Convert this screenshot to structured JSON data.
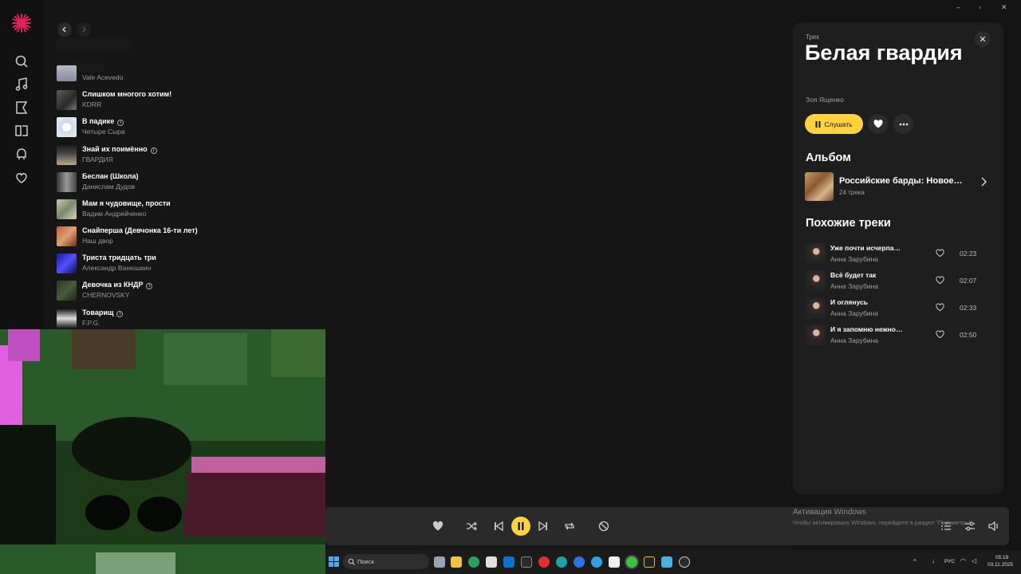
{
  "tracks": [
    {
      "title": "",
      "artist": "Vale Acevedo",
      "info": false
    },
    {
      "title": "Слишком многого хотим!",
      "artist": "KDRR",
      "info": false
    },
    {
      "title": "В падике",
      "artist": "Четыре Сыра",
      "info": true
    },
    {
      "title": "Знай их поимённо",
      "artist": "ГВАРДИЯ",
      "info": true
    },
    {
      "title": "Беслан (Школа)",
      "artist": "Данислам Дудов",
      "info": false
    },
    {
      "title": "Мам я чудовище, прости",
      "artist": "Вадим Андрейченко",
      "info": false
    },
    {
      "title": "Снайперша (Девчонка 16-ти лет)",
      "artist": "Наш двор",
      "info": false
    },
    {
      "title": "Триста тридцать три",
      "artist": "Александр Ванюшкин",
      "info": false
    },
    {
      "title": "Девочка из КНДР",
      "artist": "CHERNOVSKY",
      "info": true
    },
    {
      "title": "Товарищ",
      "artist": "F.P.G.",
      "info": true
    }
  ],
  "panel": {
    "type_label": "Трек",
    "title": "Белая гвардия",
    "artist": "Зоя Ященко",
    "listen_label": "Слушать",
    "close_symbol": "✕",
    "album_heading": "Альбом",
    "album_name": "Российские барды: Новое…",
    "album_count": "24 трека",
    "similar_heading": "Похожие треки",
    "similar": [
      {
        "title": "Уже почти исчерпа…",
        "artist": "Анна Зарубина",
        "duration": "02:23"
      },
      {
        "title": "Всё будет так",
        "artist": "Анна Зарубина",
        "duration": "02:07"
      },
      {
        "title": "И оглянусь",
        "artist": "Анна Зарубина",
        "duration": "02:33"
      },
      {
        "title": "И я запомню нежно…",
        "artist": "Анна Зарубина",
        "duration": "02:50"
      }
    ]
  },
  "player": {
    "icons": [
      "heart-icon",
      "shuffle-icon",
      "previous-icon",
      "pause-icon",
      "next-icon",
      "repeat-icon",
      "no-dislike-icon",
      "queue-icon",
      "equalizer-icon",
      "volume-icon"
    ]
  },
  "activation": {
    "title": "Активация Windows",
    "subtitle": "Чтобы активировать Windows, перейдите в раздел \"Параметры\"."
  },
  "taskbar": {
    "search_placeholder": "Поиск",
    "lang": "РУС",
    "time": "05:19",
    "date": "03.11.2025"
  },
  "colors": {
    "accent": "#ffd43b",
    "background": "#141414",
    "panel": "#1e1e1e",
    "logo": "#e8215a"
  }
}
